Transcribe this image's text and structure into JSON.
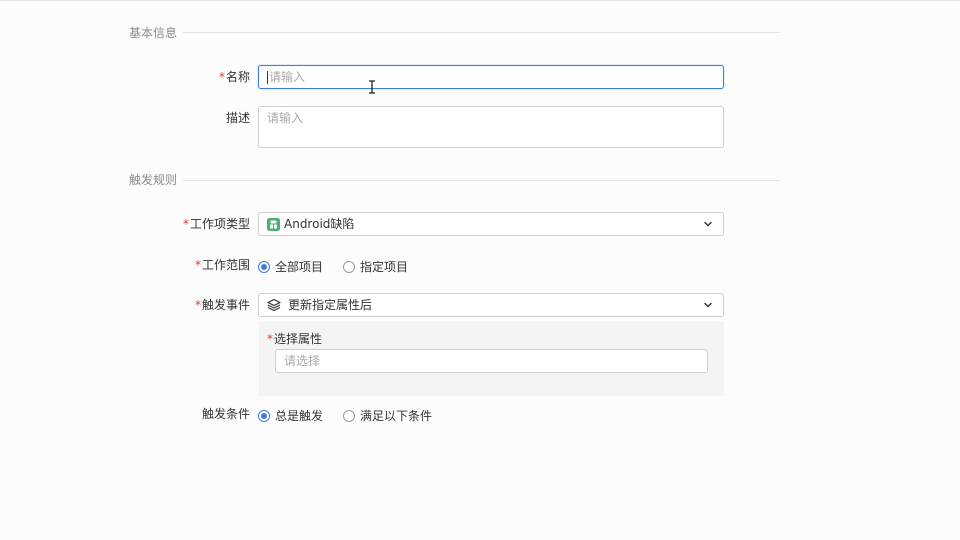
{
  "sections": {
    "basic_info": "基本信息",
    "trigger_rules": "触发规则"
  },
  "required_mark": "*",
  "form": {
    "name": {
      "label": "名称",
      "placeholder": "请输入"
    },
    "description": {
      "label": "描述",
      "placeholder": "请输入"
    },
    "work_item_type": {
      "label": "工作项类型",
      "value": "Android缺陷",
      "icon": "android-icon"
    },
    "work_scope": {
      "label": "工作范围",
      "options": [
        "全部项目",
        "指定项目"
      ],
      "selected": 0
    },
    "trigger_event": {
      "label": "触发事件",
      "value": "更新指定属性后",
      "icon": "layers-icon"
    },
    "select_attribute": {
      "label": "选择属性",
      "placeholder": "请选择"
    },
    "trigger_condition": {
      "label": "触发条件",
      "options": [
        "总是触发",
        "满足以下条件"
      ],
      "selected": 0
    }
  },
  "colors": {
    "accent": "#3b7ddd",
    "required": "#e53935",
    "android_icon": "#4caf72"
  }
}
